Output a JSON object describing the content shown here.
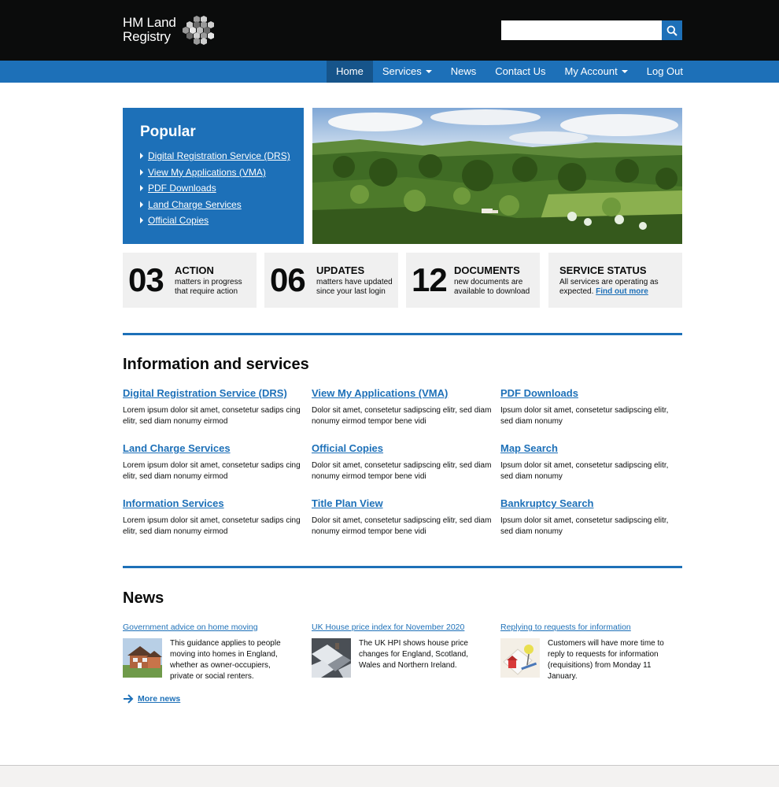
{
  "header": {
    "brand_line1": "HM Land",
    "brand_line2": "Registry",
    "crest_icon": "hexagon-crest-icon",
    "search_placeholder": "",
    "search_icon": "search-icon"
  },
  "nav": {
    "items": [
      {
        "label": "Home",
        "active": true
      },
      {
        "label": "Services",
        "dropdown": true
      },
      {
        "label": "News"
      },
      {
        "label": "Contact Us"
      },
      {
        "label": "My Account",
        "dropdown": true
      },
      {
        "label": "Log Out"
      }
    ]
  },
  "popular": {
    "title": "Popular",
    "links": [
      "Digital Registration Service (DRS)",
      "View My Applications (VMA)",
      "PDF Downloads",
      "Land Charge Services",
      "Official Copies"
    ]
  },
  "stats": [
    {
      "number": "03",
      "label": "ACTION",
      "desc": "matters in progress that require action"
    },
    {
      "number": "06",
      "label": "UPDATES",
      "desc": "matters have updated since your last login"
    },
    {
      "number": "12",
      "label": "DOCUMENTS",
      "desc": "new documents are available to download"
    }
  ],
  "service_status": {
    "label": "SERVICE STATUS",
    "desc": "All services are operating as expected.",
    "link": "Find out more"
  },
  "info": {
    "title": "Information and services",
    "services": [
      {
        "title": "Digital Registration Service (DRS)",
        "desc": "Lorem ipsum dolor sit amet, consetetur sadips cing elitr, sed diam nonumy eirmod"
      },
      {
        "title": "View My Applications (VMA)",
        "desc": "Dolor sit amet, consetetur sadipscing elitr, sed diam nonumy eirmod tempor bene vidi"
      },
      {
        "title": "PDF Downloads",
        "desc": "Ipsum dolor sit amet, consetetur sadipscing elitr, sed diam nonumy"
      },
      {
        "title": "Land Charge Services",
        "desc": "Lorem ipsum dolor sit amet, consetetur sadips cing elitr, sed diam nonumy eirmod"
      },
      {
        "title": "Official Copies",
        "desc": "Dolor sit amet, consetetur sadipscing elitr, sed diam nonumy eirmod tempor bene vidi"
      },
      {
        "title": "Map Search",
        "desc": "Ipsum dolor sit amet, consetetur sadipscing elitr, sed diam nonumy"
      },
      {
        "title": "Information Services",
        "desc": "Lorem ipsum dolor sit amet, consetetur sadips cing elitr, sed diam nonumy eirmod"
      },
      {
        "title": "Title Plan View",
        "desc": "Dolor sit amet, consetetur sadipscing elitr, sed diam nonumy eirmod tempor bene vidi"
      },
      {
        "title": "Bankruptcy Search",
        "desc": "Ipsum dolor sit amet, consetetur sadipscing elitr, sed diam nonumy"
      }
    ]
  },
  "news": {
    "title": "News",
    "items": [
      {
        "title": "Government advice on home moving",
        "text": "This guidance applies to people moving into homes in England, whether as owner-occupiers, private or social renters."
      },
      {
        "title": "UK House price index for November 2020",
        "text": "The UK HPI shows house price changes for England, Scotland, Wales and Northern Ireland."
      },
      {
        "title": "Replying to requests for information",
        "text": "Customers will have more time to reply to requests for information (requisitions) from Monday 11 January."
      }
    ],
    "more_label": "More news",
    "more_icon": "arrow-right-icon"
  },
  "colors": {
    "header_bg": "#0b0c0c",
    "brand_blue": "#1d70b8",
    "nav_active": "#16548a",
    "stat_bg": "#f0f0f0"
  }
}
